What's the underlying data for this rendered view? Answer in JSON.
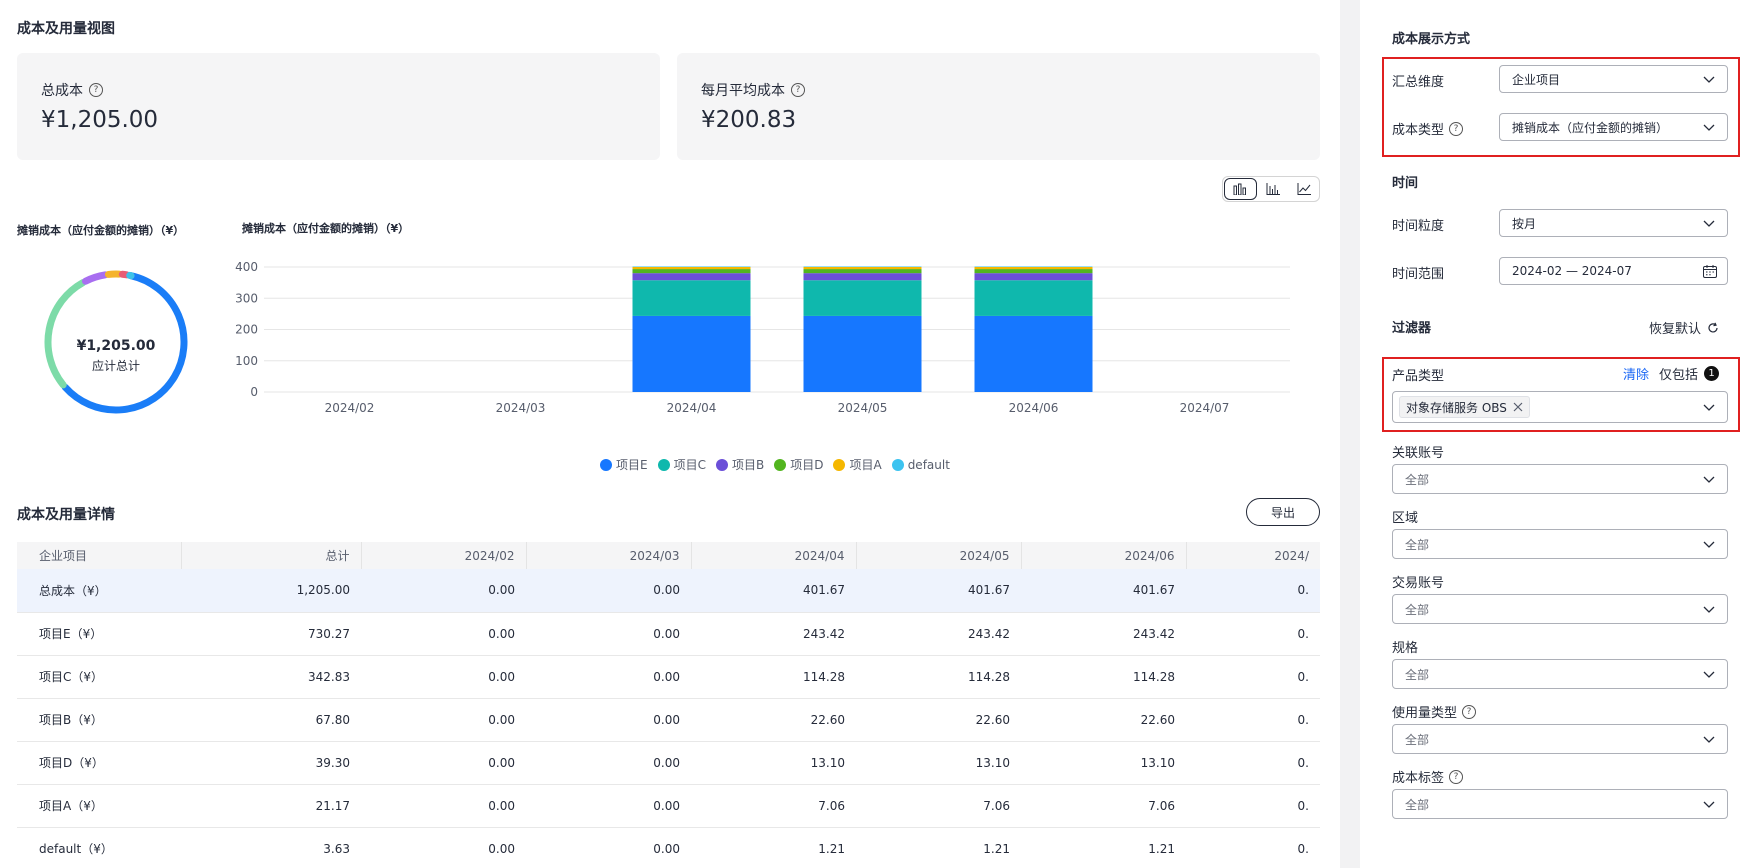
{
  "page": {
    "title": "成本及用量视图"
  },
  "summary": {
    "total_label": "总成本",
    "total_value": "¥1,205.00",
    "monthly_label": "每月平均成本",
    "monthly_value": "¥200.83"
  },
  "donut": {
    "title": "摊销成本（应付金额的摊销）（¥）",
    "center_value": "¥1,205.00",
    "center_label": "应计总计"
  },
  "chart_controls": {
    "selected": "stacked-bar-icon",
    "options": [
      "stacked-bar-icon",
      "bar-icon",
      "line-icon"
    ]
  },
  "chart_data": [
    {
      "type": "pie",
      "title": "摊销成本（应付金额的摊销）（¥）",
      "categories": [
        "项目E",
        "项目C",
        "项目B",
        "项目D",
        "项目A",
        "default"
      ],
      "values": [
        730.27,
        342.83,
        67.8,
        39.3,
        21.17,
        3.63
      ],
      "colors": [
        "#1a7df7",
        "#7ddba8",
        "#a86ef0",
        "#f5b32b",
        "#e85d75",
        "#3ec2e8"
      ]
    },
    {
      "type": "bar",
      "stacked": true,
      "title": "摊销成本（应付金额的摊销）（¥）",
      "categories": [
        "2024/02",
        "2024/03",
        "2024/04",
        "2024/05",
        "2024/06",
        "2024/07"
      ],
      "ylim": [
        0,
        400
      ],
      "yticks": [
        0,
        100,
        200,
        300,
        400
      ],
      "series": [
        {
          "name": "项目E",
          "color": "#1677ff",
          "values": [
            0,
            0,
            243.42,
            243.42,
            243.42,
            0
          ]
        },
        {
          "name": "项目C",
          "color": "#0fb8ad",
          "values": [
            0,
            0,
            114.28,
            114.28,
            114.28,
            0
          ]
        },
        {
          "name": "项目B",
          "color": "#6b4fd8",
          "values": [
            0,
            0,
            22.6,
            22.6,
            22.6,
            0
          ]
        },
        {
          "name": "项目D",
          "color": "#52b51f",
          "values": [
            0,
            0,
            13.1,
            13.1,
            13.1,
            0
          ]
        },
        {
          "name": "项目A",
          "color": "#f5b700",
          "values": [
            0,
            0,
            7.06,
            7.06,
            7.06,
            0
          ]
        },
        {
          "name": "default",
          "color": "#3cc3f0",
          "values": [
            0,
            0,
            1.21,
            1.21,
            1.21,
            0
          ]
        }
      ],
      "legend": "bottom",
      "grid": true
    }
  ],
  "details": {
    "title": "成本及用量详情",
    "export_label": "导出",
    "columns": [
      "企业项目",
      "总计",
      "2024/02",
      "2024/03",
      "2024/04",
      "2024/05",
      "2024/06",
      "2024/"
    ],
    "rows": [
      [
        "总成本（¥）",
        "1,205.00",
        "0.00",
        "0.00",
        "401.67",
        "401.67",
        "401.67",
        "0."
      ],
      [
        "项目E（¥）",
        "730.27",
        "0.00",
        "0.00",
        "243.42",
        "243.42",
        "243.42",
        "0."
      ],
      [
        "项目C（¥）",
        "342.83",
        "0.00",
        "0.00",
        "114.28",
        "114.28",
        "114.28",
        "0."
      ],
      [
        "项目B（¥）",
        "67.80",
        "0.00",
        "0.00",
        "22.60",
        "22.60",
        "22.60",
        "0."
      ],
      [
        "项目D（¥）",
        "39.30",
        "0.00",
        "0.00",
        "13.10",
        "13.10",
        "13.10",
        "0."
      ],
      [
        "项目A（¥）",
        "21.17",
        "0.00",
        "0.00",
        "7.06",
        "7.06",
        "7.06",
        "0."
      ],
      [
        "default（¥）",
        "3.63",
        "0.00",
        "0.00",
        "1.21",
        "1.21",
        "1.21",
        "0."
      ]
    ]
  },
  "sidebar": {
    "display_title": "成本展示方式",
    "summary_dim_label": "汇总维度",
    "summary_dim_value": "企业项目",
    "cost_type_label": "成本类型",
    "cost_type_value": "摊销成本（应付金额的摊销）",
    "time_title": "时间",
    "granularity_label": "时间粒度",
    "granularity_value": "按月",
    "range_label": "时间范围",
    "range_value": "2024-02 — 2024-07",
    "filter_title": "过滤器",
    "reset_label": "恢复默认",
    "product_type_label": "产品类型",
    "clear_label": "清除",
    "only_include_label": "仅包括",
    "only_include_count": "1",
    "product_tag": "对象存储服务 OBS",
    "filters": [
      {
        "label": "关联账号",
        "value": "全部",
        "help": false
      },
      {
        "label": "区域",
        "value": "全部",
        "help": false
      },
      {
        "label": "交易账号",
        "value": "全部",
        "help": false
      },
      {
        "label": "规格",
        "value": "全部",
        "help": false
      },
      {
        "label": "使用量类型",
        "value": "全部",
        "help": true
      },
      {
        "label": "成本标签",
        "value": "全部",
        "help": true
      }
    ]
  }
}
